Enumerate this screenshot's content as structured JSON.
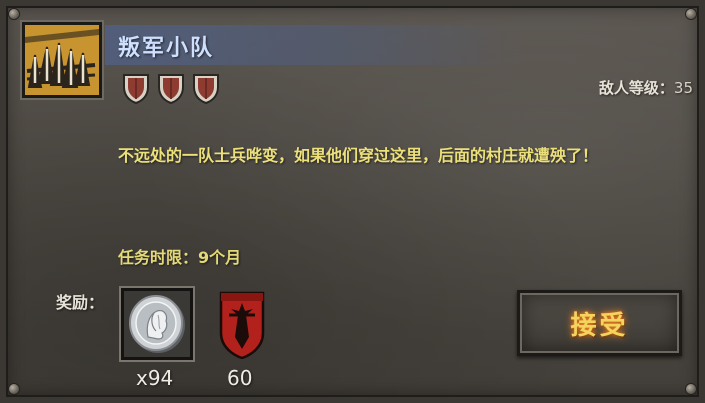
{
  "mission": {
    "icon": "rebel-spikes-icon",
    "title": "叛军小队",
    "difficulty_shields": 3,
    "enemy_level_label": "敌人等级：",
    "enemy_level_value": "35",
    "description": "不远处的一队士兵哗变，如果他们穿过这里，后面的村庄就遭殃了！",
    "time_limit": "任务时限：9个月"
  },
  "rewards": {
    "label": "奖励：",
    "items": [
      {
        "icon": "silver-coin-icon",
        "quantity": "x94"
      },
      {
        "icon": "war-banner-icon",
        "quantity": "60"
      }
    ]
  },
  "actions": {
    "accept_label": "接受"
  },
  "colors": {
    "title": "#cfe0ff",
    "description": "#ece07a",
    "accept_text": "#f4d35e",
    "icon_bg": "#c7942f",
    "shield": "#8e3c32",
    "banner": "#b3211c"
  }
}
